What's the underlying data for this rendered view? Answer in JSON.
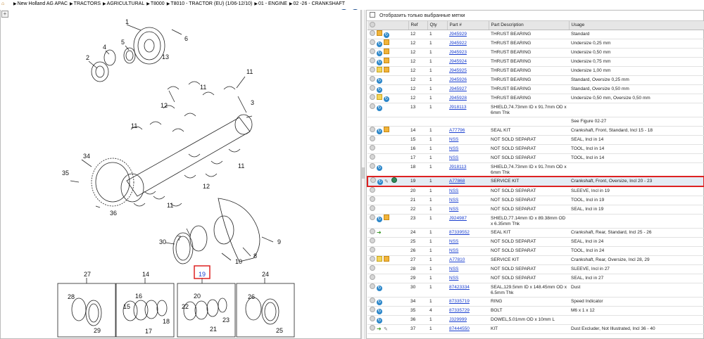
{
  "breadcrumb": {
    "items": [
      "New Holland AG APAC",
      "TRACTORS",
      "AGRICULTURAL",
      "T8000",
      "T8010 - TRACTOR (EU) (1/06-12/10)",
      "01 - ENGINE",
      "02 -26 - CRANKSHAFT"
    ]
  },
  "nav": {
    "back_icon": "back-arrow-icon",
    "forward_icon": "forward-arrow-icon"
  },
  "zoom_icon": "zoom-in-icon",
  "filter": {
    "label": "Отобразить только выбранные метки"
  },
  "table": {
    "headers": [
      "",
      "Ref",
      "Qty",
      "Part #",
      "Part Description",
      "Usage"
    ],
    "rows": [
      {
        "icons": [
          "circ",
          "box",
          "info"
        ],
        "ref": "12",
        "qty": "1",
        "part": "J945929",
        "desc": "THRUST BEARING",
        "usage": "Standard"
      },
      {
        "icons": [
          "circ",
          "info",
          "box"
        ],
        "ref": "12",
        "qty": "1",
        "part": "J945922",
        "desc": "THRUST BEARING",
        "usage": "Undersize 0,25 mm"
      },
      {
        "icons": [
          "circ",
          "info",
          "box"
        ],
        "ref": "12",
        "qty": "1",
        "part": "J945923",
        "desc": "THRUST BEARING",
        "usage": "Undersize 0,50 mm"
      },
      {
        "icons": [
          "circ",
          "info",
          "box"
        ],
        "ref": "12",
        "qty": "1",
        "part": "J945924",
        "desc": "THRUST BEARING",
        "usage": "Undersize 0,75 mm"
      },
      {
        "icons": [
          "circ",
          "note",
          "box"
        ],
        "ref": "12",
        "qty": "1",
        "part": "J945925",
        "desc": "THRUST BEARING",
        "usage": "Undersize 1,00 mm"
      },
      {
        "icons": [
          "circ",
          "info"
        ],
        "ref": "12",
        "qty": "1",
        "part": "J945926",
        "desc": "THRUST BEARING",
        "usage": "Standard, Oversize 0,25 mm"
      },
      {
        "icons": [
          "circ",
          "info"
        ],
        "ref": "12",
        "qty": "1",
        "part": "J945927",
        "desc": "THRUST BEARING",
        "usage": "Standard, Oversize 0,50 mm"
      },
      {
        "icons": [
          "circ",
          "note",
          "info"
        ],
        "ref": "12",
        "qty": "1",
        "part": "J945928",
        "desc": "THRUST BEARING",
        "usage": "Undersize 0,50 mm, Oversize 0,50 mm"
      },
      {
        "icons": [
          "circ",
          "info"
        ],
        "ref": "13",
        "qty": "1",
        "part": "J918113",
        "desc": "SHIELD,74.73mm ID x 91.7mm OD x 6mm Thk",
        "usage": "",
        "tall": true
      },
      {
        "icons": [],
        "ref": "",
        "qty": "",
        "part": "",
        "desc": "",
        "usage": "See Figure 02-27"
      },
      {
        "icons": [
          "circ",
          "info",
          "box"
        ],
        "ref": "14",
        "qty": "1",
        "part": "A77796",
        "desc": "SEAL KIT",
        "usage": "Crankshaft, Front, Standard, Incl 15 - 18"
      },
      {
        "icons": [
          "circ"
        ],
        "ref": "15",
        "qty": "1",
        "part": "NSS",
        "desc": "NOT SOLD SEPARAT",
        "usage": "SEAL, Incl in 14"
      },
      {
        "icons": [
          "circ"
        ],
        "ref": "16",
        "qty": "1",
        "part": "NSS",
        "desc": "NOT SOLD SEPARAT",
        "usage": "TOOL, Incl in 14"
      },
      {
        "icons": [
          "circ"
        ],
        "ref": "17",
        "qty": "1",
        "part": "NSS",
        "desc": "NOT SOLD SEPARAT",
        "usage": "TOOL, Incl in 14"
      },
      {
        "icons": [
          "circ",
          "info"
        ],
        "ref": "18",
        "qty": "1",
        "part": "J918113",
        "desc": "SHIELD,74.73mm ID x 91.7mm OD x 6mm Thk",
        "usage": "",
        "tall": true
      },
      {
        "icons": [
          "circ",
          "info",
          "wrench",
          "globe"
        ],
        "ref": "19",
        "qty": "1",
        "part": "A77868",
        "desc": "SERVICE KIT",
        "usage": "Crankshaft, Front, Oversize, Incl 20 - 23",
        "selected": true
      },
      {
        "icons": [
          "circ"
        ],
        "ref": "20",
        "qty": "1",
        "part": "NSS",
        "desc": "NOT SOLD SEPARAT",
        "usage": "SLEEVE, Incl in 19"
      },
      {
        "icons": [
          "circ"
        ],
        "ref": "21",
        "qty": "1",
        "part": "NSS",
        "desc": "NOT SOLD SEPARAT",
        "usage": "TOOL, Incl in 19"
      },
      {
        "icons": [
          "circ"
        ],
        "ref": "22",
        "qty": "1",
        "part": "NSS",
        "desc": "NOT SOLD SEPARAT",
        "usage": "SEAL, Incl in 19"
      },
      {
        "icons": [
          "circ",
          "info",
          "box"
        ],
        "ref": "23",
        "qty": "1",
        "part": "J924987",
        "desc": "SHIELD,77.14mm ID x 89.38mm OD x 6.35mm Thk",
        "usage": "",
        "tall": true
      },
      {
        "icons": [
          "circ",
          "arrow"
        ],
        "ref": "24",
        "qty": "1",
        "part": "87339552",
        "desc": "SEAL KIT",
        "usage": "Crankshaft, Rear, Standard, Incl 25 - 26"
      },
      {
        "icons": [
          "circ"
        ],
        "ref": "25",
        "qty": "1",
        "part": "NSS",
        "desc": "NOT SOLD SEPARAT",
        "usage": "SEAL, Incl in 24"
      },
      {
        "icons": [
          "circ"
        ],
        "ref": "26",
        "qty": "1",
        "part": "NSS",
        "desc": "NOT SOLD SEPARAT",
        "usage": "TOOL, Incl in 24"
      },
      {
        "icons": [
          "circ",
          "note",
          "box"
        ],
        "ref": "27",
        "qty": "1",
        "part": "A77810",
        "desc": "SERVICE KIT",
        "usage": "Crankshaft, Rear, Oversize, Incl 28, 29"
      },
      {
        "icons": [
          "circ"
        ],
        "ref": "28",
        "qty": "1",
        "part": "NSS",
        "desc": "NOT SOLD SEPARAT",
        "usage": "SLEEVE, Incl in 27"
      },
      {
        "icons": [
          "circ"
        ],
        "ref": "29",
        "qty": "1",
        "part": "NSS",
        "desc": "NOT SOLD SEPARAT",
        "usage": "SEAL, Incl in 27"
      },
      {
        "icons": [
          "circ",
          "info"
        ],
        "ref": "30",
        "qty": "1",
        "part": "87423334",
        "desc": "SEAL,129.5mm ID x 148.45mm OD x 6.5mm Thk",
        "usage": "Dust",
        "tall": true
      },
      {
        "icons": [
          "circ",
          "info"
        ],
        "ref": "34",
        "qty": "1",
        "part": "87335719",
        "desc": "RING",
        "usage": "Speed Indicator"
      },
      {
        "icons": [
          "circ",
          "info"
        ],
        "ref": "35",
        "qty": "4",
        "part": "87335729",
        "desc": "BOLT",
        "usage": "M6 x 1 x 12"
      },
      {
        "icons": [
          "circ",
          "info"
        ],
        "ref": "36",
        "qty": "1",
        "part": "J329999",
        "desc": "DOWEL,5.01mm OD x 10mm L",
        "usage": ""
      },
      {
        "icons": [
          "circ",
          "arrow",
          "wrench"
        ],
        "ref": "37",
        "qty": "1",
        "part": "87444550",
        "desc": "KIT",
        "usage": "Dust Excluder, Not Illustrated, Incl 36 - 40"
      }
    ]
  },
  "diagram": {
    "callouts": [
      "1",
      "2",
      "3",
      "4",
      "5",
      "6",
      "7",
      "8",
      "9",
      "10",
      "11",
      "11",
      "11",
      "11",
      "11",
      "12",
      "12",
      "13",
      "34",
      "35",
      "36",
      "30"
    ],
    "kit_labels": [
      "27",
      "14",
      "19",
      "24"
    ],
    "kit_parts": {
      "k27": [
        "28",
        "29"
      ],
      "k14": [
        "15",
        "16",
        "17",
        "18"
      ],
      "k19": [
        "22",
        "20",
        "21",
        "23"
      ],
      "k24": [
        "26",
        "25"
      ]
    },
    "highlight": "19"
  }
}
